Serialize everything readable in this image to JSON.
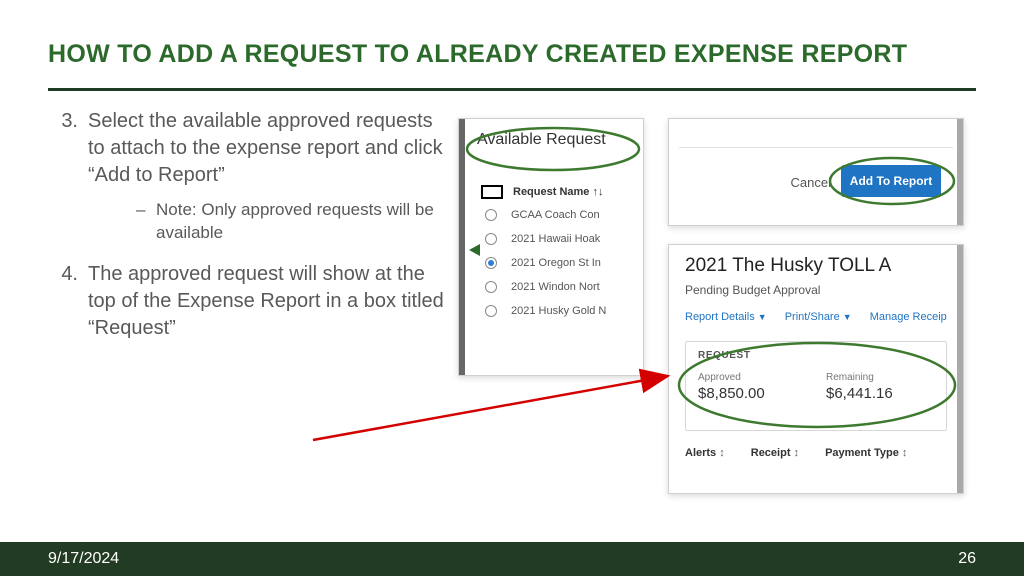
{
  "title": "HOW TO ADD A REQUEST TO ALREADY CREATED EXPENSE REPORT",
  "steps": [
    {
      "num": "3.",
      "text": "Select the available approved requests to attach to the expense report and click “Add to Report”",
      "sub": [
        "Note: Only approved requests will be available"
      ]
    },
    {
      "num": "4.",
      "text": "The approved request will show at the top of the Expense Report in a box titled “Request”"
    }
  ],
  "panel1": {
    "heading": "Available Request",
    "column": "Request Name ↑↓",
    "rows": [
      {
        "sel": false,
        "text": "GCAA Coach Con"
      },
      {
        "sel": false,
        "text": "2021 Hawaii Hoak"
      },
      {
        "sel": true,
        "text": "2021 Oregon St In"
      },
      {
        "sel": false,
        "text": "2021 Windon Nort"
      },
      {
        "sel": false,
        "text": "2021 Husky Gold N"
      }
    ]
  },
  "panel2": {
    "cancel": "Cancel",
    "button": "Add To Report"
  },
  "panel3": {
    "title": "2021 The Husky TOLL A",
    "status": "Pending Budget Approval",
    "links": {
      "details": "Report Details",
      "print": "Print/Share",
      "manage": "Manage Receip"
    },
    "request": {
      "label": "REQUEST",
      "approved_lbl": "Approved",
      "approved_val": "$8,850.00",
      "remaining_lbl": "Remaining",
      "remaining_val": "$6,441.16"
    },
    "columns": [
      "Alerts",
      "Receipt",
      "Payment Type"
    ]
  },
  "footer": {
    "date": "9/17/2024",
    "page": "26"
  }
}
